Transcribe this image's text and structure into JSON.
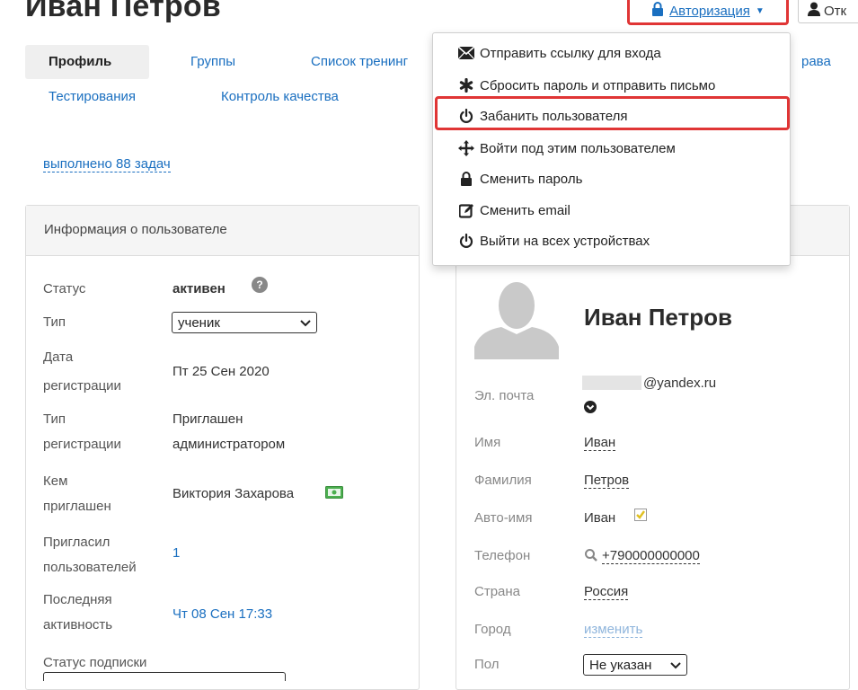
{
  "page": {
    "title": "Иван Петров"
  },
  "header": {
    "auth_label": "Авторизация",
    "exit_label": "Отк"
  },
  "tabs": [
    {
      "label": "Профиль"
    },
    {
      "label": "Группы"
    },
    {
      "label": "Список тренинг"
    },
    {
      "label": "рава"
    },
    {
      "label": "Тестирования"
    },
    {
      "label": "Контроль качества"
    }
  ],
  "tasks_link": "выполнено 88 задач",
  "dropdown": {
    "items": [
      {
        "label": "Отправить ссылку для входа",
        "icon": "envelope-icon"
      },
      {
        "label": "Сбросить пароль и отправить письмо",
        "icon": "asterisk-icon"
      },
      {
        "label": "Забанить пользователя",
        "icon": "power-icon"
      },
      {
        "label": "Войти под этим пользователем",
        "icon": "move-icon"
      },
      {
        "label": "Сменить пароль",
        "icon": "lock-icon"
      },
      {
        "label": "Сменить email",
        "icon": "edit-icon"
      },
      {
        "label": "Выйти на всех устройствах",
        "icon": "power-icon"
      }
    ]
  },
  "left_panel": {
    "header": "Информация о пользователе",
    "status_label": "Статус",
    "status_value": "активен",
    "type_label": "Тип",
    "type_value": "ученик",
    "regdate_label_1": "Дата",
    "regdate_label_2": "регистрации",
    "regdate_value": "Пт 25 Сен 2020",
    "regtype_label_1": "Тип",
    "regtype_label_2": "регистрации",
    "regtype_value_1": "Приглашен",
    "regtype_value_2": "администратором",
    "invitedby_label_1": "Кем",
    "invitedby_label_2": "приглашен",
    "invitedby_value": "Виктория Захарова",
    "invited_label_1": "Пригласил",
    "invited_label_2": "пользователей",
    "invited_value": "1",
    "lastactive_label_1": "Последняя",
    "lastactive_label_2": "активность",
    "lastactive_value": "Чт 08 Сен 17:33",
    "subscription_label": "Статус подписки"
  },
  "right_panel": {
    "name": "Иван Петров",
    "email_label": "Эл. почта",
    "email_value": "@yandex.ru",
    "firstname_label": "Имя",
    "firstname_value": "Иван",
    "lastname_label": "Фамилия",
    "lastname_value": "Петров",
    "autoname_label": "Авто-имя",
    "autoname_value": "Иван",
    "phone_label": "Телефон",
    "phone_value": "+790000000000",
    "country_label": "Страна",
    "country_value": "Россия",
    "city_label": "Город",
    "city_value": "изменить",
    "gender_label": "Пол",
    "gender_value": "Не указан"
  },
  "colors": {
    "accent": "#1a6fc0",
    "highlight": "#e03535",
    "check": "#e0c020"
  }
}
